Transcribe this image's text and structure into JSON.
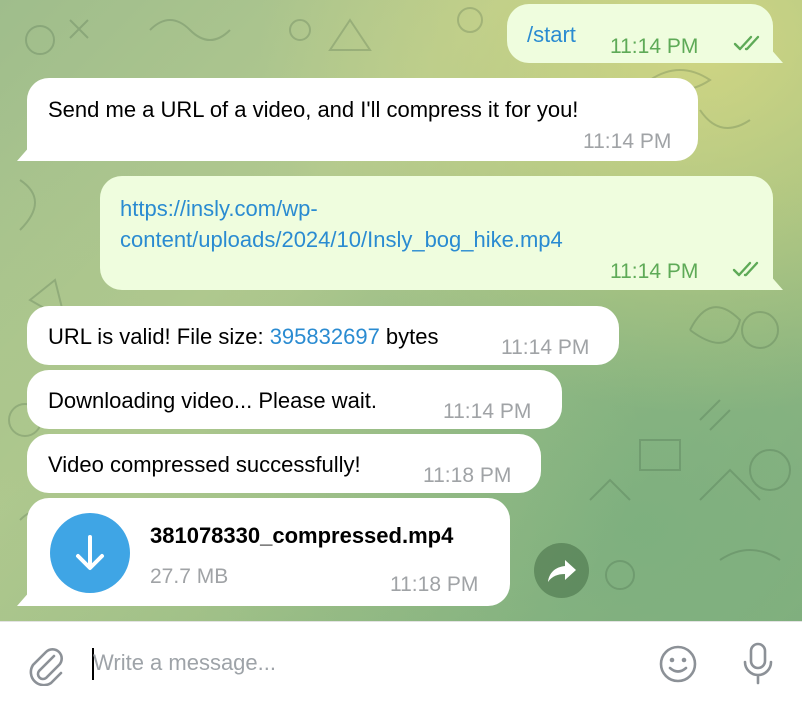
{
  "messages": [
    {
      "direction": "out",
      "text": "/start",
      "time": "11:14 PM",
      "read": true
    },
    {
      "direction": "in",
      "text": "Send me a URL of a video, and I'll compress it for you!",
      "time": "11:14 PM"
    },
    {
      "direction": "out",
      "link_line1": "https://insly.com/wp-",
      "link_line2": "content/uploads/2024/10/Insly_bog_hike.mp4",
      "time": "11:14 PM",
      "read": true
    },
    {
      "direction": "in",
      "text_before": "URL is valid! File size: ",
      "value": "395832697",
      "text_after": " bytes",
      "time": "11:14 PM"
    },
    {
      "direction": "in",
      "text": "Downloading video... Please wait.",
      "time": "11:14 PM"
    },
    {
      "direction": "in",
      "text": "Video compressed successfully!",
      "time": "11:18 PM"
    },
    {
      "direction": "in",
      "type": "file",
      "file_name": "381078330_compressed.mp4",
      "file_size": "27.7 MB",
      "time": "11:18 PM"
    }
  ],
  "composer": {
    "placeholder": "Write a message..."
  },
  "icons": {
    "attach": "paperclip-icon",
    "emoji": "smiley-icon",
    "voice": "microphone-icon",
    "download": "download-arrow-icon",
    "forward": "forward-arrow-icon",
    "read": "double-check-icon"
  },
  "colors": {
    "incoming": "#ffffff",
    "outgoing": "#effdde",
    "link": "#2a8bd1",
    "outgoing_time": "#5eaa57",
    "file_icon": "#3fa5e5"
  }
}
